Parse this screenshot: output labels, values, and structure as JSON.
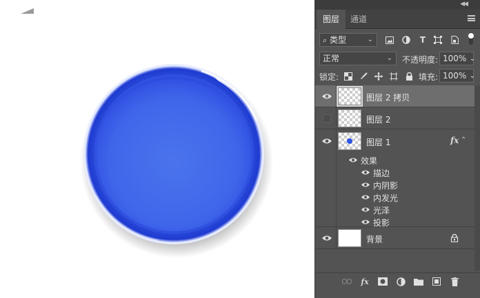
{
  "panel": {
    "tabs": [
      {
        "label": "图层",
        "active": true
      },
      {
        "label": "通道",
        "active": false
      }
    ],
    "filter": {
      "kind_label": "类型"
    },
    "blend_mode": "正常",
    "opacity": {
      "label": "不透明度:",
      "value": "100%"
    },
    "lock": {
      "label": "锁定:"
    },
    "fill": {
      "label": "填充:",
      "value": "100%"
    },
    "layers": [
      {
        "name": "图层 2 拷贝",
        "visible": true,
        "selected": true
      },
      {
        "name": "图层 2",
        "visible": false,
        "selected": false
      },
      {
        "name": "图层 1",
        "visible": true,
        "selected": false,
        "has_fx": true,
        "fx_label": "fx",
        "effects_header": "效果",
        "effects": [
          "描边",
          "内阴影",
          "内发光",
          "光泽",
          "投影"
        ]
      },
      {
        "name": "背景",
        "visible": true,
        "selected": false,
        "locked": true
      }
    ],
    "bottom_icons": [
      "link-layers-icon",
      "fx-icon",
      "add-mask-icon",
      "adjustment-layer-icon",
      "new-group-icon",
      "new-layer-icon",
      "delete-icon"
    ],
    "bottom_fx_label": "fx"
  },
  "canvas": {
    "button_color": "#2e55e6"
  }
}
